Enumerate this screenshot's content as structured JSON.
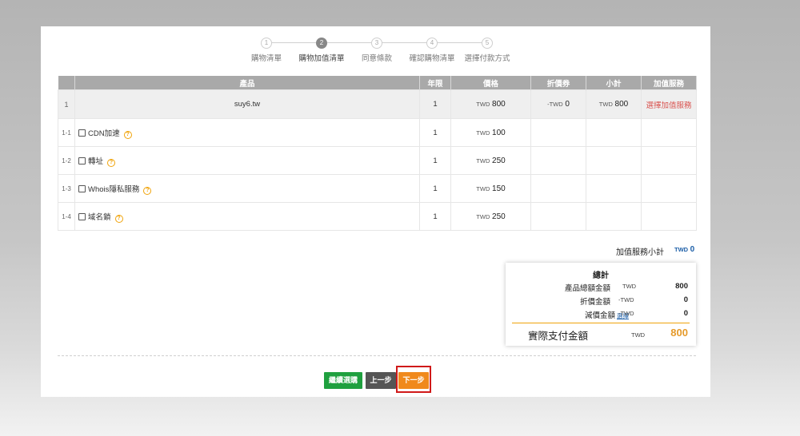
{
  "steps": [
    {
      "num": "1",
      "label": "購物清單"
    },
    {
      "num": "2",
      "label": "購物加值清單"
    },
    {
      "num": "3",
      "label": "同意條款"
    },
    {
      "num": "4",
      "label": "確認購物清單"
    },
    {
      "num": "5",
      "label": "選擇付款方式"
    }
  ],
  "active_step": 2,
  "table": {
    "headers": {
      "product": "產品",
      "years": "年限",
      "price": "價格",
      "discount": "折價券",
      "subtotal": "小計",
      "addon": "加值服務"
    },
    "main_row": {
      "idx": "1",
      "name": "suy6.tw",
      "years": "1",
      "price_cur": "TWD",
      "price": "800",
      "discount_cur": "-TWD",
      "discount": "0",
      "subtotal_cur": "TWD",
      "subtotal": "800",
      "addon_link": "選擇加值服務"
    },
    "addons": [
      {
        "idx": "1-1",
        "name": "CDN加速",
        "years": "1",
        "price_cur": "TWD",
        "price": "100"
      },
      {
        "idx": "1-2",
        "name": "轉址",
        "years": "1",
        "price_cur": "TWD",
        "price": "250"
      },
      {
        "idx": "1-3",
        "name": "Whois隱私服務",
        "years": "1",
        "price_cur": "TWD",
        "price": "150"
      },
      {
        "idx": "1-4",
        "name": "域名鎖",
        "years": "1",
        "price_cur": "TWD",
        "price": "250"
      }
    ]
  },
  "addon_subtotal": {
    "label": "加值服務小計",
    "currency": "TWD",
    "value": "0"
  },
  "summary": {
    "title": "總計",
    "product_total": {
      "label": "產品總額金額",
      "currency": "TWD",
      "value": "800"
    },
    "discount": {
      "label": "折價金額",
      "currency": "-TWD",
      "value": "0"
    },
    "reduction": {
      "label": "減價金額",
      "select": "選擇",
      "currency": "-TWD",
      "value": "0"
    },
    "actual": {
      "label": "實際支付金額",
      "currency": "TWD",
      "value": "800"
    }
  },
  "buttons": {
    "continue": "繼續選購",
    "prev": "上一步",
    "next": "下一步"
  },
  "colors": {
    "header_bg": "#a9a9a9",
    "continue": "#1fa03f",
    "prev": "#555555",
    "next": "#f0891c",
    "highlight": "#d01919",
    "total": "#e59a2a",
    "addon_link": "#d9534f"
  }
}
